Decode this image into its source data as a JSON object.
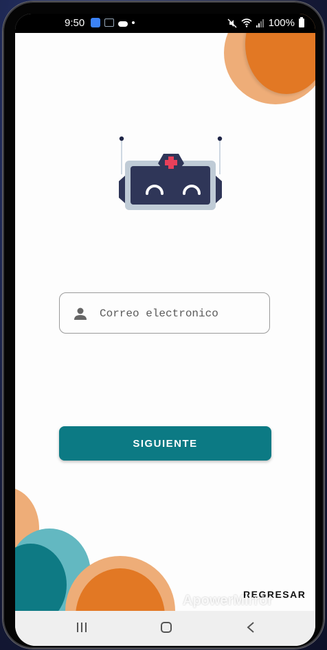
{
  "status_bar": {
    "time": "9:50",
    "battery": "100%",
    "icons": [
      "app-badge-icon",
      "notification-icon",
      "cloud-icon",
      "dot-icon",
      "mute-icon",
      "wifi-icon",
      "signal-icon",
      "battery-icon"
    ]
  },
  "login": {
    "email_placeholder": "Correo electronico",
    "email_value": "",
    "next_button_label": "SIGUIENTE",
    "back_label": "REGRESAR"
  },
  "overlay": {
    "watermark": "ApowerMirror"
  },
  "colors": {
    "primary": "#0c7a84",
    "accent_orange": "#e27824",
    "accent_peach": "#eead78",
    "accent_teal_light": "#63b8c1",
    "robot_dark": "#2f3658",
    "robot_cross": "#e8405a"
  }
}
